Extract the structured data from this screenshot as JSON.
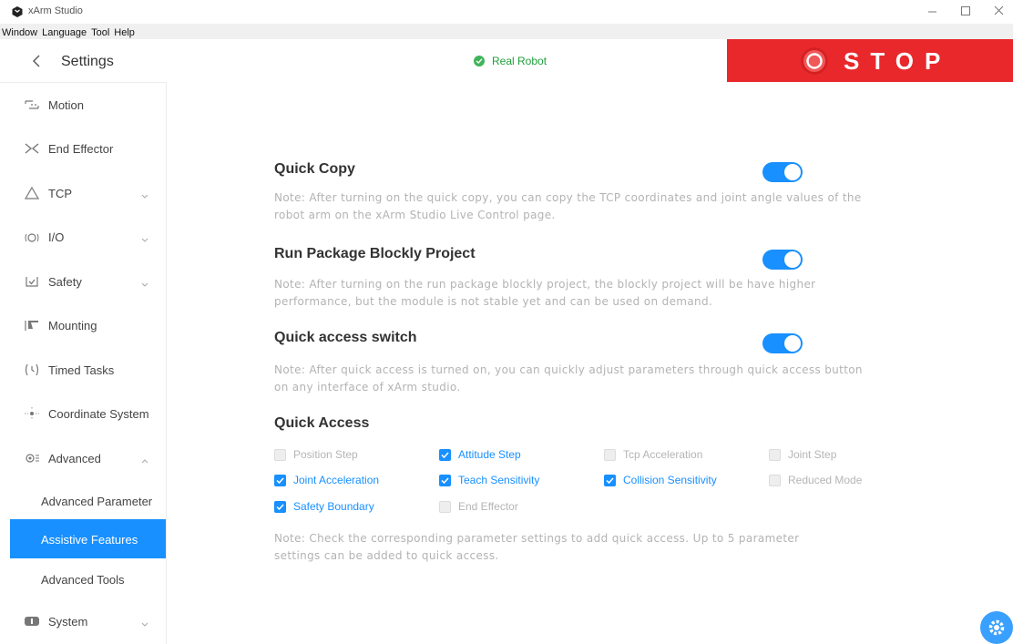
{
  "window": {
    "title": "xArm Studio",
    "icon": "xarm-logo-icon"
  },
  "menu": [
    "Window",
    "Language",
    "Tool",
    "Help"
  ],
  "header": {
    "title": "Settings",
    "status_label": "Real Robot",
    "status_color": "#41b35a",
    "stop_label": "STOP",
    "stop_color": "#e8282b"
  },
  "sidebar": {
    "items": [
      {
        "label": "Motion",
        "icon": "motion-icon"
      },
      {
        "label": "End Effector",
        "icon": "end-effector-icon"
      },
      {
        "label": "TCP",
        "icon": "tcp-icon",
        "expandable": true
      },
      {
        "label": "I/O",
        "icon": "io-icon",
        "expandable": true
      },
      {
        "label": "Safety",
        "icon": "safety-icon",
        "expandable": true
      },
      {
        "label": "Mounting",
        "icon": "mounting-icon"
      },
      {
        "label": "Timed Tasks",
        "icon": "timed-tasks-icon"
      },
      {
        "label": "Coordinate System",
        "icon": "coordinate-system-icon"
      },
      {
        "label": "Advanced",
        "icon": "advanced-icon",
        "expanded": true
      },
      {
        "label": "System",
        "icon": "system-icon",
        "expandable": true
      }
    ],
    "advanced_children": [
      {
        "label": "Advanced Parameter",
        "active": false
      },
      {
        "label": "Assistive Features",
        "active": true
      },
      {
        "label": "Advanced Tools",
        "active": false
      }
    ]
  },
  "main": {
    "sections": [
      {
        "title": "Quick Copy",
        "enabled": true,
        "note": "Note: After turning on the quick copy, you can copy the TCP coordinates and joint angle values of the robot arm on the xArm Studio Live Control page."
      },
      {
        "title": "Run Package Blockly Project",
        "enabled": true,
        "note": "Note: After turning on the run package blockly project, the blockly project will be have higher performance, but the module is not stable yet and can be used on demand."
      },
      {
        "title": "Quick access switch",
        "enabled": true,
        "note": "Note: After quick access is turned on, you can quickly adjust parameters through quick access button on any interface of xArm studio."
      }
    ],
    "quick_access": {
      "title": "Quick Access",
      "options": [
        {
          "label": "Position Step",
          "checked": false
        },
        {
          "label": "Attitude Step",
          "checked": true
        },
        {
          "label": "Tcp Acceleration",
          "checked": false
        },
        {
          "label": "Joint Step",
          "checked": false
        },
        {
          "label": "Joint Acceleration",
          "checked": true
        },
        {
          "label": "Teach Sensitivity",
          "checked": true
        },
        {
          "label": "Collision Sensitivity",
          "checked": true
        },
        {
          "label": "Reduced Mode",
          "checked": false
        },
        {
          "label": "Safety Boundary",
          "checked": true
        },
        {
          "label": "End Effector",
          "checked": false
        }
      ],
      "note": "Note: Check the corresponding parameter settings to add quick access. Up to 5 parameter settings can be added to quick access."
    }
  },
  "colors": {
    "accent": "#1890ff",
    "note_text": "#b3b3b3"
  },
  "floating_button_icon": "gear-icon"
}
